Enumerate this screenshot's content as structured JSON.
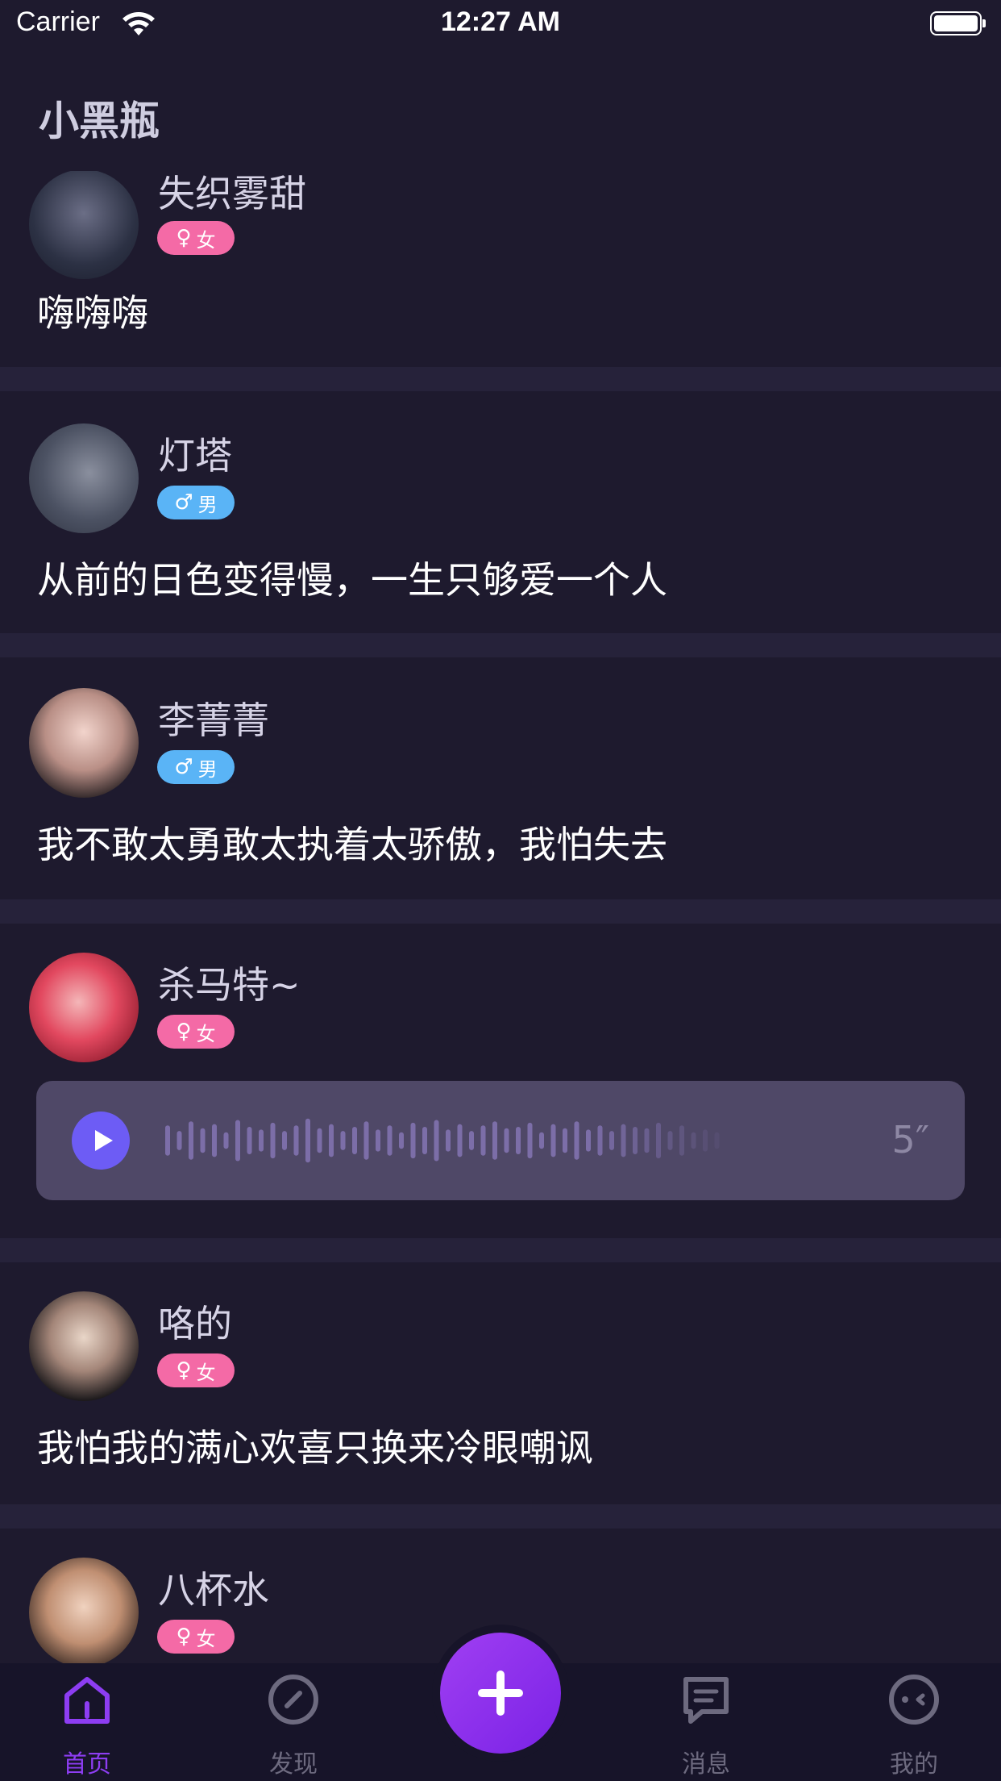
{
  "status_bar": {
    "carrier": "Carrier",
    "time": "12:27 AM"
  },
  "page": {
    "title": "小黑瓶"
  },
  "posts": [
    {
      "name": "失织雾甜",
      "gender": "女",
      "gender_type": "female",
      "text": "嗨嗨嗨"
    },
    {
      "name": "灯塔",
      "gender": "男",
      "gender_type": "male",
      "text": "从前的日色变得慢，一生只够爱一个人"
    },
    {
      "name": "李菁菁",
      "gender": "男",
      "gender_type": "male",
      "text": "我不敢太勇敢太执着太骄傲，我怕失去"
    },
    {
      "name": "杀马特~",
      "gender": "女",
      "gender_type": "female",
      "voice_duration": "5″"
    },
    {
      "name": "咯的",
      "gender": "女",
      "gender_type": "female",
      "text": "我怕我的满心欢喜只换来冷眼嘲讽"
    },
    {
      "name": "八杯水",
      "gender": "女",
      "gender_type": "female"
    }
  ],
  "tabs": [
    {
      "label": "首页",
      "icon": "home-icon",
      "active": true
    },
    {
      "label": "发现",
      "icon": "compass-icon",
      "active": false
    },
    {
      "label": "消息",
      "icon": "message-icon",
      "active": false
    },
    {
      "label": "我的",
      "icon": "profile-face-icon",
      "active": false
    }
  ],
  "fab": {
    "icon": "plus-icon"
  },
  "colors": {
    "background": "#1e1a2e",
    "accent": "#8d3df2",
    "female_badge": "#f46aa6",
    "male_badge": "#5ab4f6"
  }
}
